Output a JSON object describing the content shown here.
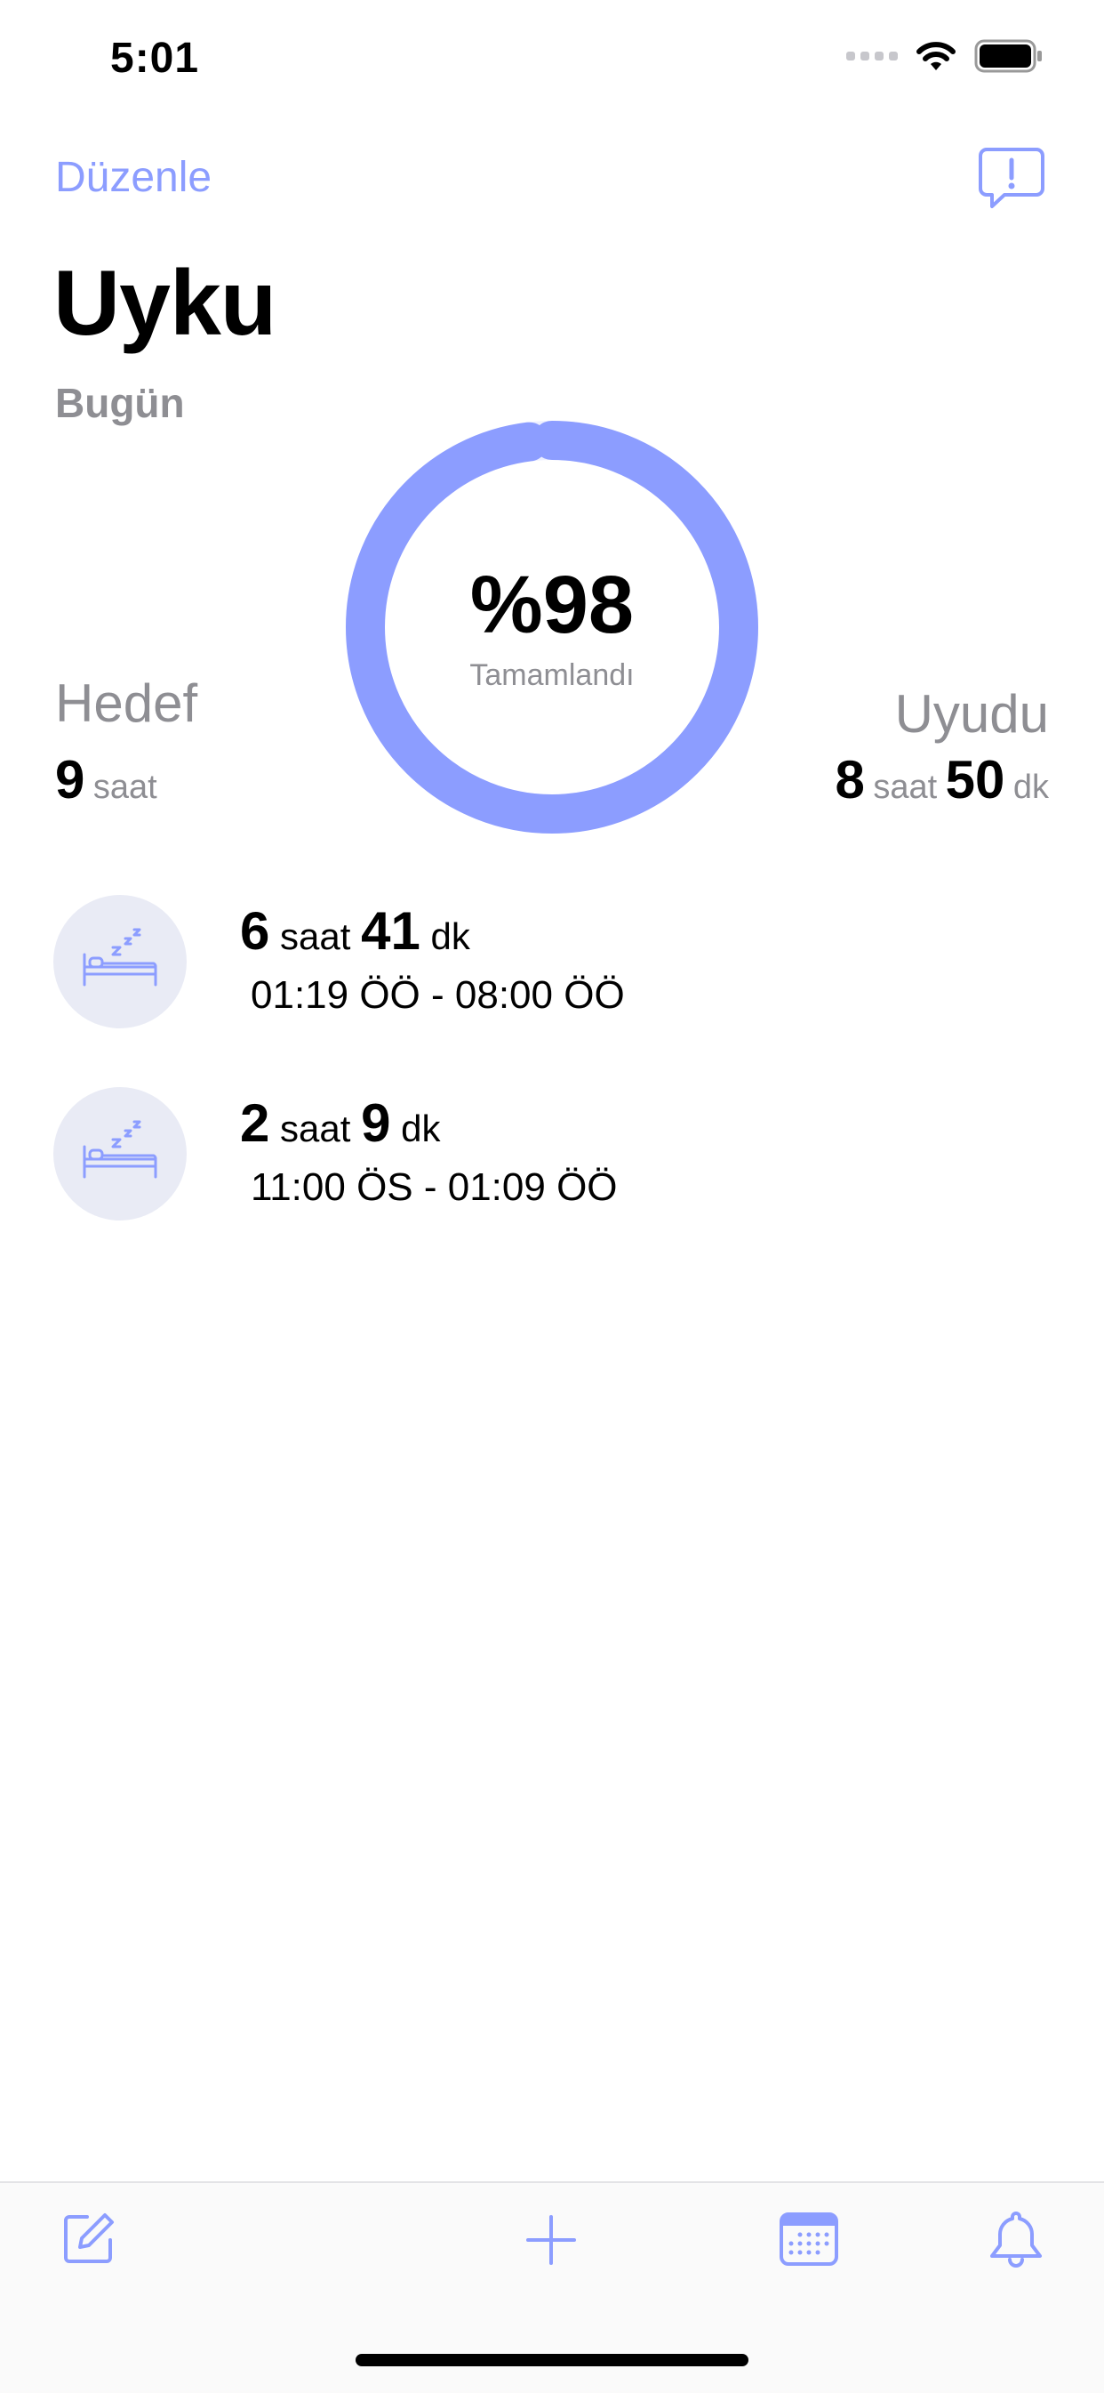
{
  "status_bar": {
    "time": "5:01"
  },
  "nav": {
    "edit_label": "Düzenle"
  },
  "page": {
    "title": "Uyku",
    "date_label": "Bugün"
  },
  "ring": {
    "percent_label": "%98",
    "sub_label": "Tamamlandı",
    "progress": 0.98,
    "color": "#8c9dff"
  },
  "goal": {
    "title": "Hedef",
    "hours": "9",
    "hours_unit": "saat"
  },
  "slept": {
    "title": "Uyudu",
    "hours": "8",
    "hours_unit": "saat",
    "minutes": "50",
    "minutes_unit": "dk"
  },
  "sessions": [
    {
      "hours": "6",
      "hours_unit": "saat",
      "minutes": "41",
      "minutes_unit": "dk",
      "range": "01:19 ÖÖ - 08:00 ÖÖ",
      "icon": "bed-sleep-icon"
    },
    {
      "hours": "2",
      "hours_unit": "saat",
      "minutes": "9",
      "minutes_unit": "dk",
      "range": "11:00 ÖS - 01:09 ÖÖ",
      "icon": "bed-sleep-icon"
    }
  ],
  "tab_bar": {
    "icons": [
      "compose-icon",
      "plus-icon",
      "calendar-icon",
      "bell-icon"
    ]
  },
  "colors": {
    "accent": "#8c9dff",
    "secondary_text": "#8e8e93",
    "avatar_bg": "#e9ebf5"
  }
}
